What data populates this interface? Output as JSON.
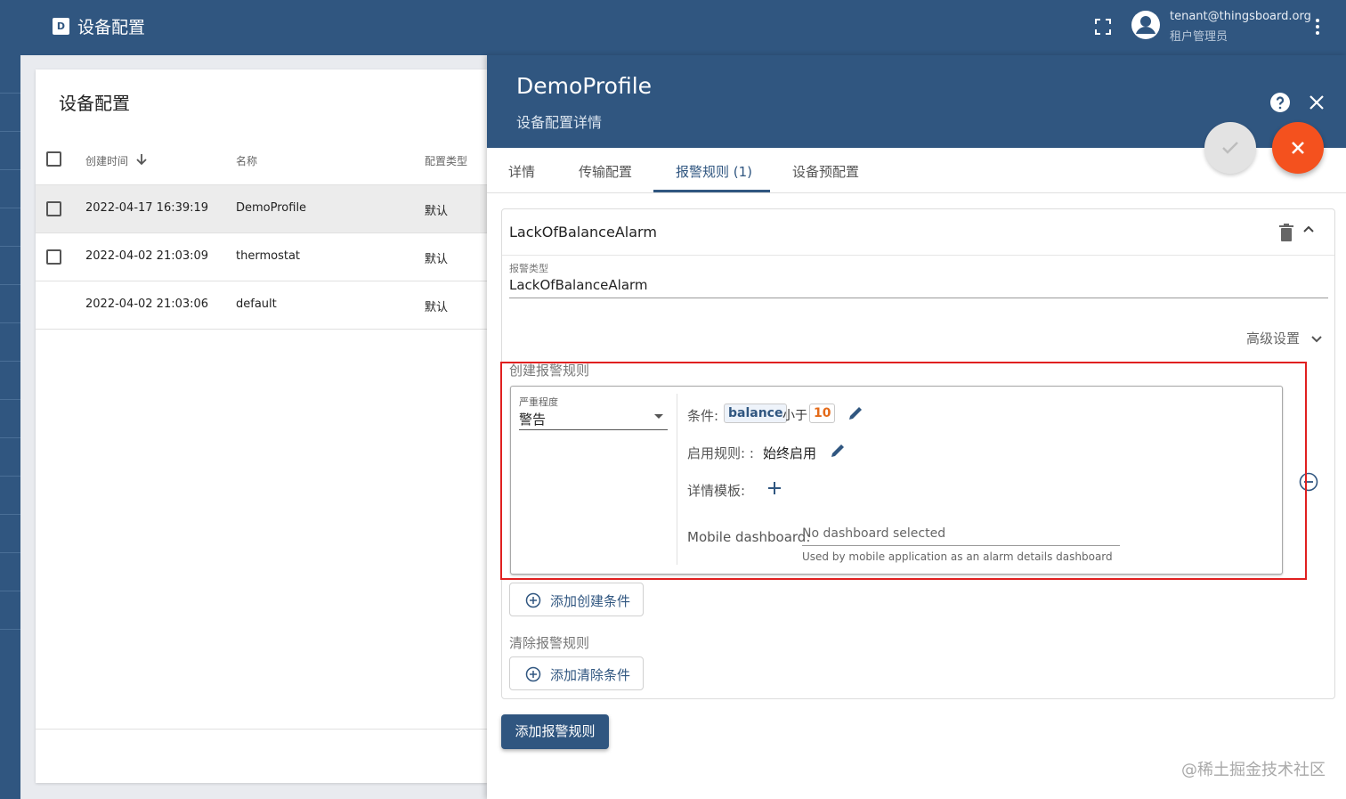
{
  "topbar": {
    "logo_letter": "D",
    "title": "设备配置",
    "user_email": "tenant@thingsboard.org",
    "user_role": "租户管理员"
  },
  "list": {
    "title": "设备配置",
    "columns": [
      "创建时间",
      "名称",
      "配置类型"
    ],
    "rows": [
      {
        "created": "2022-04-17 16:39:19",
        "name": "DemoProfile",
        "type": "默认"
      },
      {
        "created": "2022-04-02 21:03:09",
        "name": "thermostat",
        "type": "默认"
      },
      {
        "created": "2022-04-02 21:03:06",
        "name": "default",
        "type": "默认"
      }
    ]
  },
  "details": {
    "name": "DemoProfile",
    "subtitle": "设备配置详情",
    "tabs": [
      "详情",
      "传输配置",
      "报警规则 (1)",
      "设备预配置"
    ],
    "active_tab": "报警规则 (1)",
    "alarm": {
      "name": "LackOfBalanceAlarm",
      "type_label": "报警类型",
      "type_value": "LackOfBalanceAlarm",
      "advanced_label": "高级设置",
      "create_rules_label": "创建报警规则",
      "severity_label": "严重程度",
      "severity_value": "警告",
      "condition_label": "条件:",
      "condition_key": "balance",
      "condition_op": "小于",
      "condition_value": "10",
      "schedule_label": "启用规则: :",
      "schedule_value": "始终启用",
      "template_label": "详情模板:",
      "mobile_label": "Mobile dashboard:",
      "mobile_value": "No dashboard selected",
      "mobile_hint": "Used by mobile application as an alarm details dashboard",
      "add_create_condition": "添加创建条件",
      "clear_rules_label": "清除报警规则",
      "add_clear_condition": "添加清除条件"
    },
    "add_alarm_rule": "添加报警规则"
  },
  "watermark": "@稀土掘金技术社区",
  "colors": {
    "primary": "#305680",
    "accent": "#f4511e",
    "value_orange": "#e46a18",
    "highlight_red": "#e02020"
  }
}
